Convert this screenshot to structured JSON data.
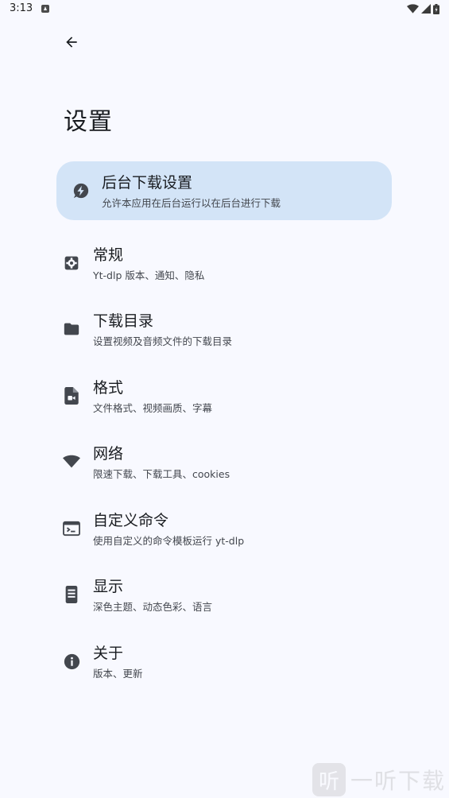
{
  "status_bar": {
    "time": "3:13"
  },
  "header": {
    "back_icon": "arrow-left-icon",
    "title": "设置"
  },
  "settings": [
    {
      "icon": "background-download-icon",
      "title": "后台下载设置",
      "subtitle": "允许本应用在后台运行以在后台进行下载",
      "highlighted": true
    },
    {
      "icon": "gear-icon",
      "title": "常规",
      "subtitle": "Yt-dlp 版本、通知、隐私"
    },
    {
      "icon": "folder-icon",
      "title": "下载目录",
      "subtitle": "设置视频及音频文件的下载目录"
    },
    {
      "icon": "video-file-icon",
      "title": "格式",
      "subtitle": "文件格式、视频画质、字幕"
    },
    {
      "icon": "wifi-icon",
      "title": "网络",
      "subtitle": "限速下载、下载工具、cookies"
    },
    {
      "icon": "terminal-icon",
      "title": "自定义命令",
      "subtitle": "使用自定义的命令模板运行 yt-dlp"
    },
    {
      "icon": "display-icon",
      "title": "显示",
      "subtitle": "深色主题、动态色彩、语言"
    },
    {
      "icon": "info-icon",
      "title": "关于",
      "subtitle": "版本、更新"
    }
  ],
  "watermark": {
    "logo_char": "听",
    "text": "一听下载"
  },
  "colors": {
    "background": "#f8f9ff",
    "highlight": "#d3e4f7",
    "icon": "#43474e"
  }
}
